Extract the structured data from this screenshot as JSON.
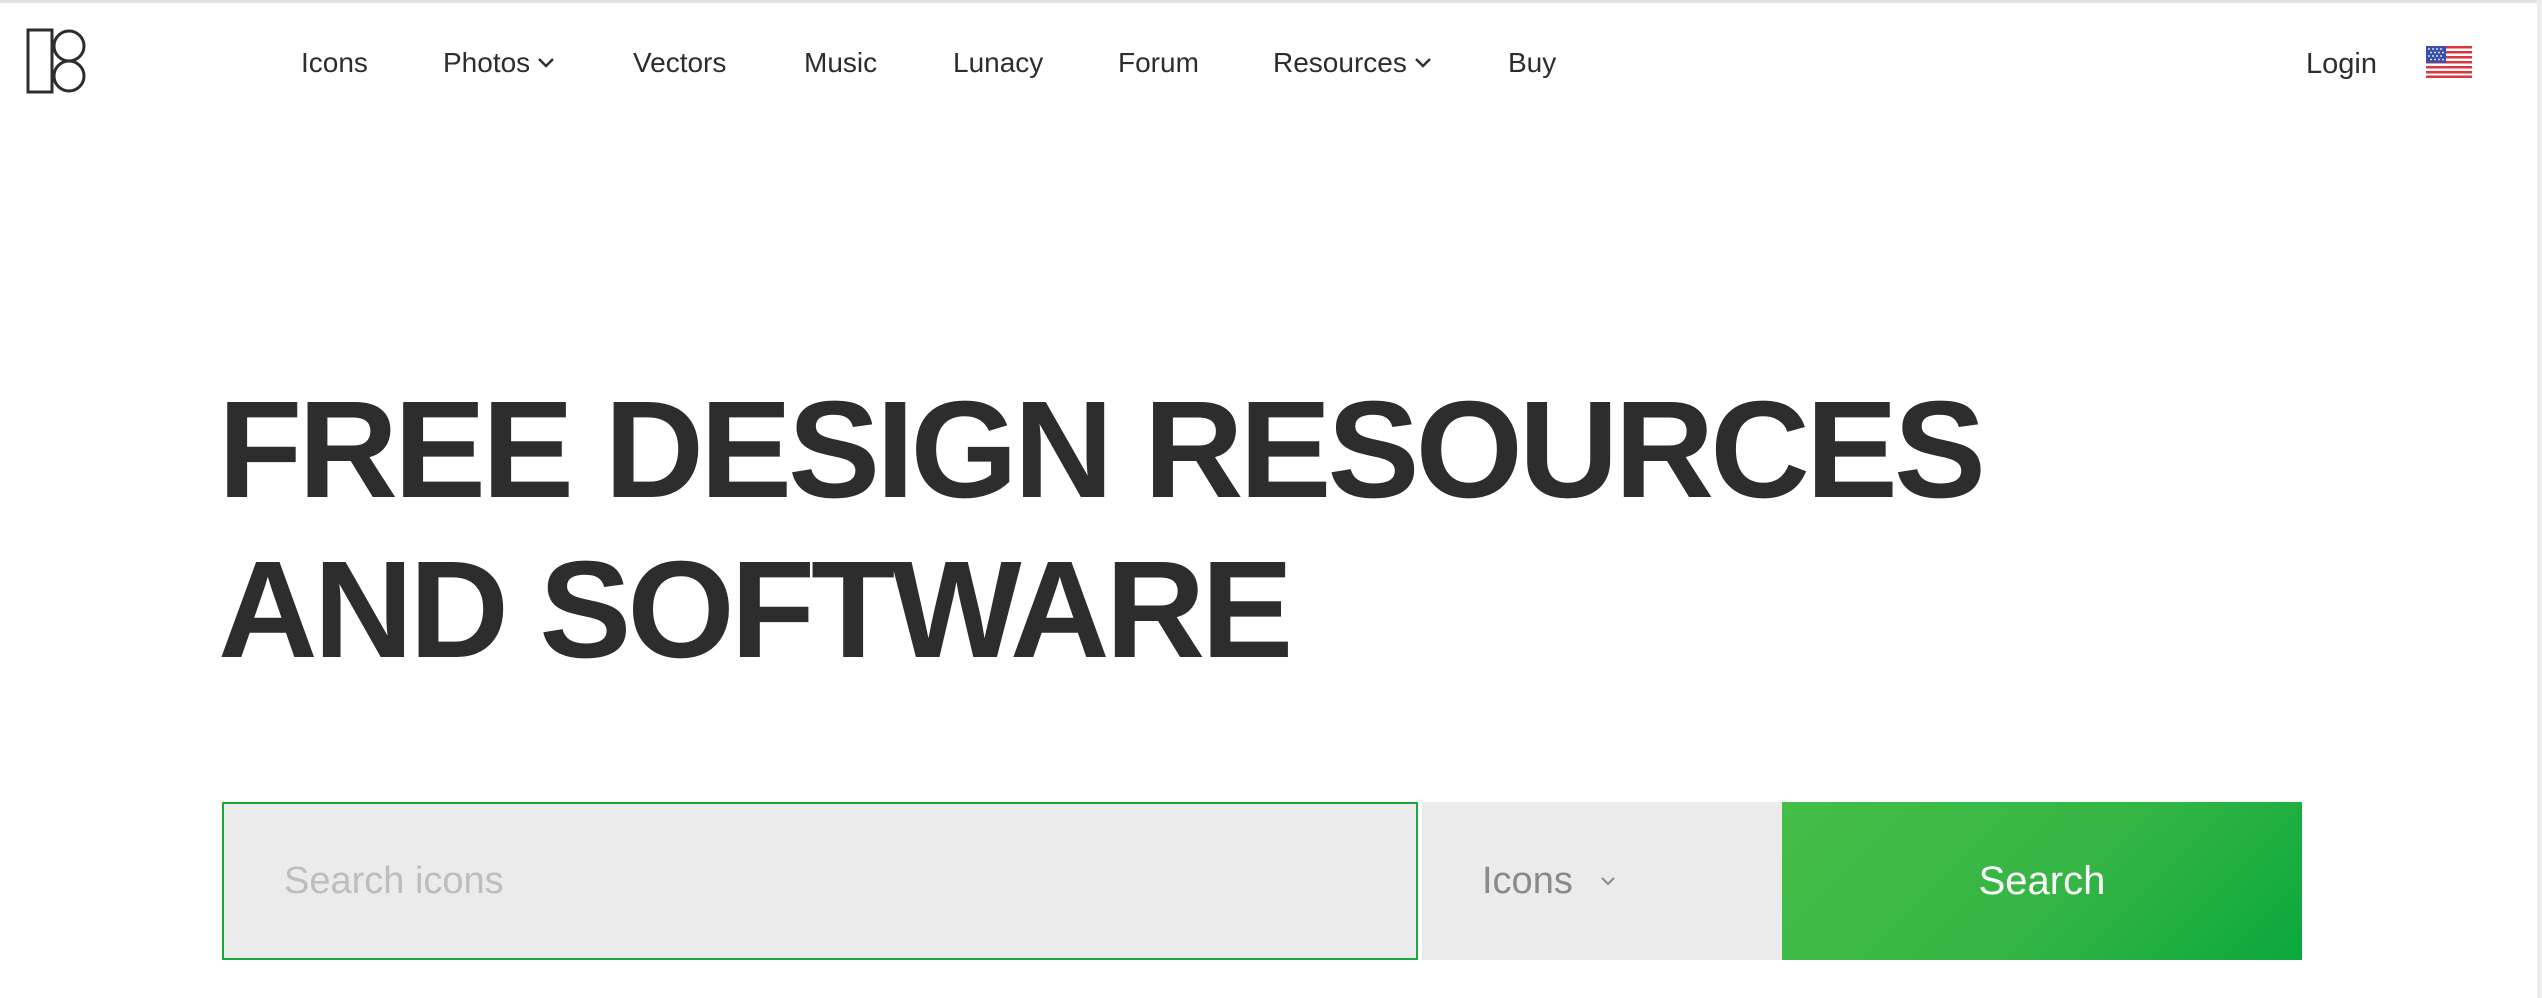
{
  "nav": {
    "items": [
      {
        "label": "Icons",
        "has_dropdown": false
      },
      {
        "label": "Photos",
        "has_dropdown": true
      },
      {
        "label": "Vectors",
        "has_dropdown": false
      },
      {
        "label": "Music",
        "has_dropdown": false
      },
      {
        "label": "Lunacy",
        "has_dropdown": false
      },
      {
        "label": "Forum",
        "has_dropdown": false
      },
      {
        "label": "Resources",
        "has_dropdown": true
      },
      {
        "label": "Buy",
        "has_dropdown": false
      }
    ],
    "login_label": "Login",
    "language_flag": "us-flag-icon"
  },
  "hero": {
    "title_line1": "FREE DESIGN RESOURCES",
    "title_line2": "AND SOFTWARE"
  },
  "search": {
    "placeholder": "Search icons",
    "value": "",
    "type_selected": "Icons",
    "button_label": "Search"
  },
  "colors": {
    "accent_green": "#1aaa3a",
    "text_dark": "#2d2d2d",
    "field_bg": "#ebebeb"
  }
}
